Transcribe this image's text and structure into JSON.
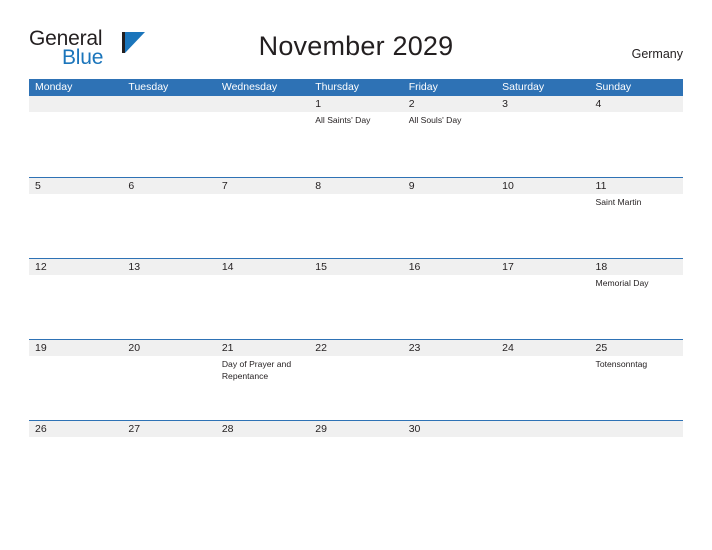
{
  "brand": {
    "name_part1": "General",
    "name_part2": "Blue",
    "flag_icon": "flag-triangle-icon",
    "accent_color": "#1b75bb"
  },
  "header": {
    "title": "November 2029",
    "country": "Germany",
    "header_bar_color": "#2e72b5",
    "number_band_color": "#f0f0f0"
  },
  "calendar": {
    "weekdays": [
      "Monday",
      "Tuesday",
      "Wednesday",
      "Thursday",
      "Friday",
      "Saturday",
      "Sunday"
    ],
    "weeks": [
      {
        "days": [
          {
            "num": "",
            "events": []
          },
          {
            "num": "",
            "events": []
          },
          {
            "num": "",
            "events": []
          },
          {
            "num": "1",
            "events": [
              "All Saints' Day"
            ]
          },
          {
            "num": "2",
            "events": [
              "All Souls' Day"
            ]
          },
          {
            "num": "3",
            "events": []
          },
          {
            "num": "4",
            "events": []
          }
        ]
      },
      {
        "days": [
          {
            "num": "5",
            "events": []
          },
          {
            "num": "6",
            "events": []
          },
          {
            "num": "7",
            "events": []
          },
          {
            "num": "8",
            "events": []
          },
          {
            "num": "9",
            "events": []
          },
          {
            "num": "10",
            "events": []
          },
          {
            "num": "11",
            "events": [
              "Saint Martin"
            ]
          }
        ]
      },
      {
        "days": [
          {
            "num": "12",
            "events": []
          },
          {
            "num": "13",
            "events": []
          },
          {
            "num": "14",
            "events": []
          },
          {
            "num": "15",
            "events": []
          },
          {
            "num": "16",
            "events": []
          },
          {
            "num": "17",
            "events": []
          },
          {
            "num": "18",
            "events": [
              "Memorial Day"
            ]
          }
        ]
      },
      {
        "days": [
          {
            "num": "19",
            "events": []
          },
          {
            "num": "20",
            "events": []
          },
          {
            "num": "21",
            "events": [
              "Day of Prayer and Repentance"
            ]
          },
          {
            "num": "22",
            "events": []
          },
          {
            "num": "23",
            "events": []
          },
          {
            "num": "24",
            "events": []
          },
          {
            "num": "25",
            "events": [
              "Totensonntag"
            ]
          }
        ]
      },
      {
        "days": [
          {
            "num": "26",
            "events": []
          },
          {
            "num": "27",
            "events": []
          },
          {
            "num": "28",
            "events": []
          },
          {
            "num": "29",
            "events": []
          },
          {
            "num": "30",
            "events": []
          },
          {
            "num": "",
            "events": []
          },
          {
            "num": "",
            "events": []
          }
        ]
      }
    ]
  }
}
